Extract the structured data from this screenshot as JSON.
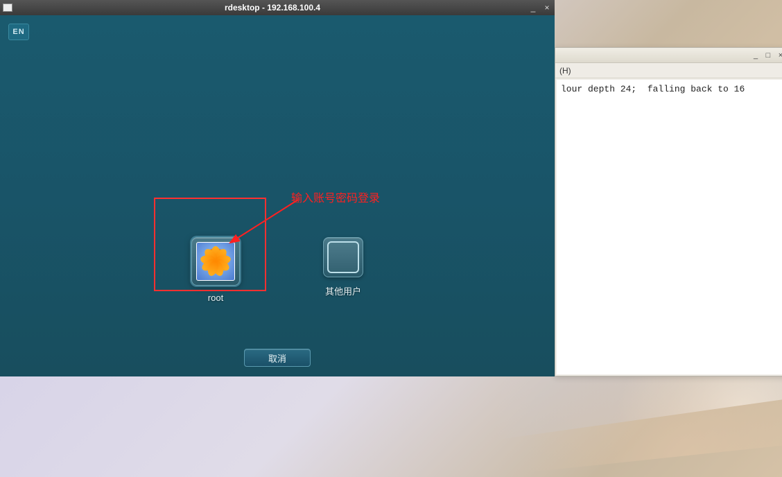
{
  "main_window": {
    "title": "rdesktop - 192.168.100.4",
    "ime_badge": "EN",
    "users": [
      {
        "label": "root"
      },
      {
        "label": "其他用户"
      }
    ],
    "cancel_label": "取消"
  },
  "terminal_window": {
    "menu_fragment": "(H)",
    "body_text": "lour depth 24;  falling back to 16"
  },
  "annotation": {
    "text": "输入账号密码登录",
    "box_color": "#ff3030"
  }
}
